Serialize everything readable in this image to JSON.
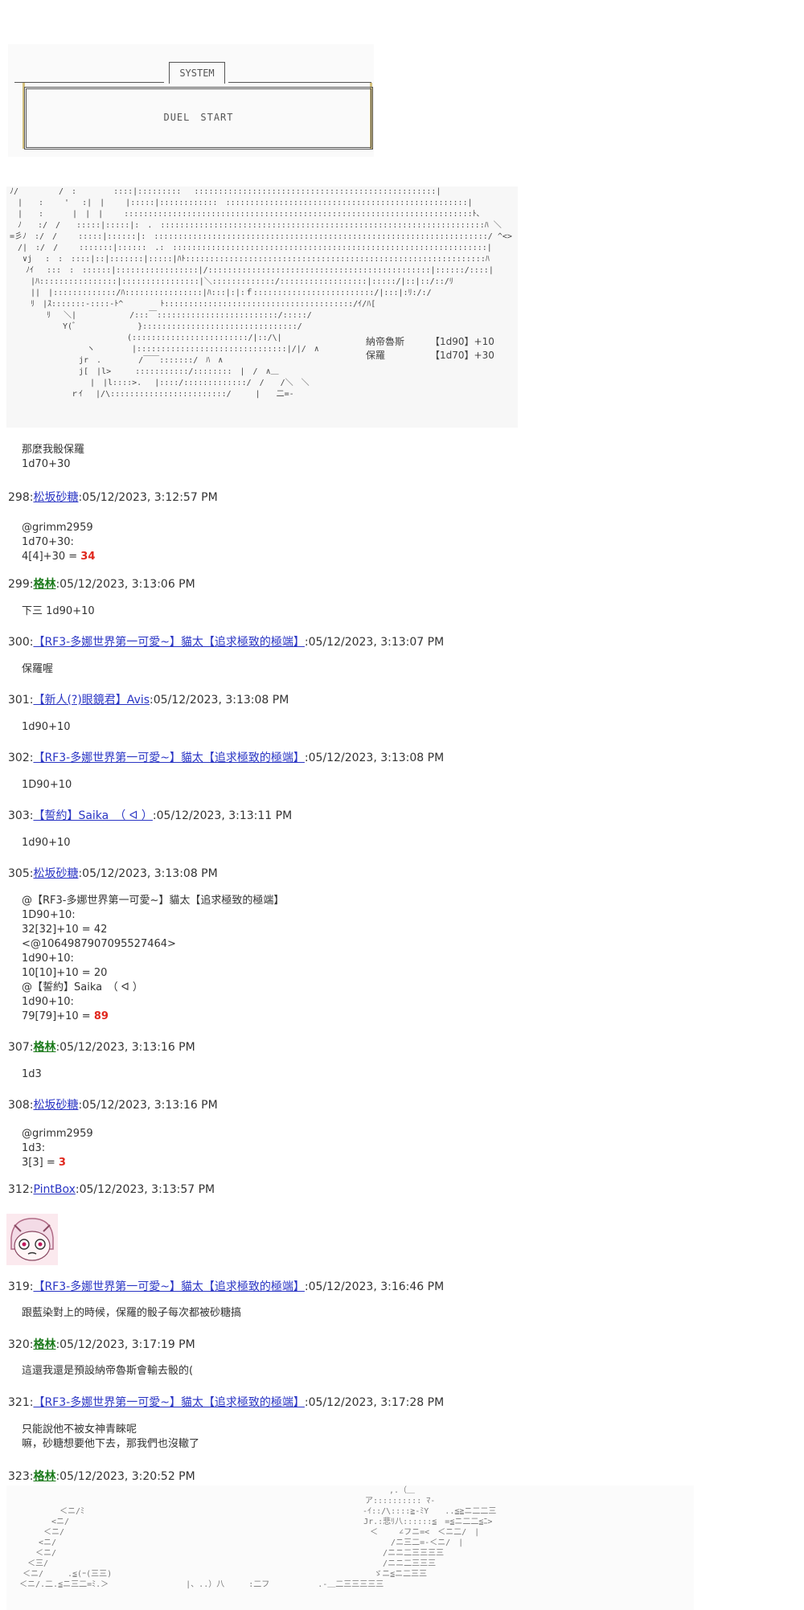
{
  "system_box": {
    "title": "SYSTEM",
    "text": "DUEL　START"
  },
  "scene_art": "ﾉ/　　　　　/　:　　　　 ::::|:::::::::　 ::::::::::::::::::::::::::::::::::::::::::::::::::|\n　|　　:　　 '　 :|　|　　 |:::::|::::::::::::　::::::::::::::::::::::::::::::::::::::::::::::::::|\n　|　　:　　　 |　|　|　　 ::::::::::::::::::::::::::::::::::::::::::::::::::::::::::::::::::::::::ﾄ､\n　ﾉ　　:/　/　　:::::|:::::|:　.　:::::::::::::::::::::::::::::::::::::::::::::::::::::::::::::::::::ﾊ ＼\n=彡ﾉ　:/　/　　 :::::|::::::|:　:::::::::::::::::::::::::::::::::::::::::::::::::::::::::::::::::::::/ ^<>\n　/|　:/　/　　 :::::::|::::::　.:　:::::::::::::::::::::::::::::::::::::::::::::::::::::::::::::::::|\n　 ∨j　 :　:　::::|::|:::::::|:::::|ﾊﾄ::::::::::::::::::::::::::::::::::::::::::::::::::::::::::::::ﾊ\n　　ﾉｲ　 :::　:　::::::|:::::::::::::::::|/::::::::::::::::::::::::::::::::::::::::::::::|::::::/::::|\n　　 |ﾊ::::::::::::::::|::::::::::::::::|＼:::::::::::::/::::::::::::::::::|:::::/|::|::/::/ﾘ\n　　 ||　|:::::::::::::/ﾊ::::::::::::::::|ﾊ:::|:|:ｆ:::::::::::::::::::::::::/|:::|:ﾘ:/:/\n　　 ﾘ　|ｽ:::::::-::::-ﾄ^　　　　 ﾄ:::::::::::::::::::::::::::::::::::::::/ｲ/ﾊ[\n　　　　 ﾘ　 ＼|　　　　　　 /:::￣:::::::::::::::::::::::::/:::::/\n　　　　　　 Y(ﾞ　　　　　　　 }::::::::::::::::::::::::::::::::/\n　　　　　　　　　　　　　　 (::::::::::::::::::::::::/|::/\\|\n　　　　　　　　　 ヽ　　　　 |:::::::::::::::::::::::::::::::|/|/　∧\n　　　　　　　　 jr　.　　　　 /￣￣:::::::/　ﾊ　∧\n　　　　　　　　 j[　|l>　　　:::::::::::/::::::::　|　/　∧＿\n　　　　　　　　　　|　|l::::>.　 |::::/:::::::::::::/　/　　/＼　＼\n　　　　　　　 ｒｲ　 |/\\::::::::::::::::::::::::/　　　|　　二=-",
  "stats": [
    {
      "name": "納帝魯斯",
      "roll": "【1d90】+10"
    },
    {
      "name": "保羅",
      "roll": "【1d70】+30"
    }
  ],
  "posts": [
    {
      "num": "",
      "author": "",
      "time": "",
      "body": "那麼我骰保羅\n1d70+30"
    },
    {
      "num": "298",
      "author": "松坂砂糖",
      "style": "link",
      "time": ":05/12/2023, 3:12:57 PM",
      "body_pre": "@grimm2959\n1d70+30:\n4[4]+30 = ",
      "highlight": "34"
    },
    {
      "num": "299",
      "author": "格林",
      "style": "green",
      "time": ":05/12/2023, 3:13:06 PM",
      "body": "下三 1d90+10"
    },
    {
      "num": "300",
      "author": "【RF3-多娜世界第一可愛~】貓太【追求極致的極端】",
      "style": "link",
      "time": ":05/12/2023, 3:13:07 PM",
      "body": "保羅喔"
    },
    {
      "num": "301",
      "author": "【新人(?)眼鏡君】Avis",
      "style": "link",
      "time": ":05/12/2023, 3:13:08 PM",
      "body": "1d90+10"
    },
    {
      "num": "302",
      "author": "【RF3-多娜世界第一可愛~】貓太【追求極致的極端】",
      "style": "link",
      "time": ":05/12/2023, 3:13:08 PM",
      "body": "1D90+10"
    },
    {
      "num": "303",
      "author": "【誓約】Saika　（ ᐊ ）",
      "style": "link",
      "time": ":05/12/2023, 3:13:11 PM",
      "body": "1d90+10"
    },
    {
      "num": "305",
      "author": "松坂砂糖",
      "style": "link",
      "time": ":05/12/2023, 3:13:08 PM",
      "body_pre": "@【RF3-多娜世界第一可愛~】貓太【追求極致的極端】\n1D90+10:\n32[32]+10 = 42\n<@1064987907095527464>\n1d90+10:\n10[10]+10 = 20\n@【誓約】Saika　（ ᐊ ）\n1d90+10:\n79[79]+10 = ",
      "highlight": "89"
    },
    {
      "num": "307",
      "author": "格林",
      "style": "green",
      "time": ":05/12/2023, 3:13:16 PM",
      "body": "1d3"
    },
    {
      "num": "308",
      "author": "松坂砂糖",
      "style": "link",
      "time": ":05/12/2023, 3:13:16 PM",
      "body_pre": "@grimm2959\n1d3:\n3[3] = ",
      "highlight": "3"
    },
    {
      "num": "312",
      "author": "PintBox",
      "style": "link",
      "time": ":05/12/2023, 3:13:57 PM",
      "body": ""
    },
    {
      "num": "319",
      "author": "【RF3-多娜世界第一可愛~】貓太【追求極致的極端】",
      "style": "link",
      "time": ":05/12/2023, 3:16:46 PM",
      "body": "跟藍染對上的時候，保羅的骰子每次都被砂糖搞"
    },
    {
      "num": "320",
      "author": "格林",
      "style": "green",
      "time": ":05/12/2023, 3:17:19 PM",
      "body": "這還我還是預設納帝魯斯會輸去骰的("
    },
    {
      "num": "321",
      "author": "【RF3-多娜世界第一可愛~】貓太【追求極致的極端】",
      "style": "link",
      "time": ":05/12/2023, 3:17:28 PM",
      "body": "只能說他不被女神青睞呢\n嘛，砂糖想要他下去，那我們也沒轍了"
    },
    {
      "num": "323",
      "author": "格林",
      "style": "green",
      "time": ":05/12/2023, 3:20:52 PM",
      "body": ""
    }
  ],
  "bottom_art": "　　　　　　　　　　　　　　　　　　　　　　　　　　　　　　　　　　　　　　　　　　　　　　　 ,.（＿\n　　　　　　　　　　　　　　　　　　　　　　　　　　　　　　　　　　　　　　　　　　　　 ア:::::::::: ﾏ-\n　　　　　　 ＜ニ/ﾐ　　　　　　　　　　　　　　　　　　　　　　　　　　　　　　　　　　 -ｲ::/\\::::≧-ﾐY　　..≦≧ニ二二三\n　　　　　 <ニ/　　　　　　　　　　　　　　　　　　　　　　　　　　　　　　　　　　　　 Jr.:悲ﾘ八::::::≦　=≦ニ二二≦ﾆ>\n　　　　 ＜ニ/　　　　　　　　　　　　　　　　　　　　　　　　　　　　　　　　　　　　　　＜　　 ∠フニ=<　＜ニ二/　|\n　　　　<ニ/　　　　　　　　　　　　　　　　　　　　　　　　　　　　　　　　　　　　　　　　　 /ニ三二=-＜ニ/　|\n　　　 ＜ニ/　　　　　　　　　　　　　　　　　　　　　　　　　　　　　　　　　　　　　　　　 /ニニ二三三三三\n　　 ＜三/　　　　　　　　　　　　　　　　　　　　　　　　　　　　　　　　　　　　　　　　　 /ニニ二三三三\n　　＜ニ/　　　.≦(ｰ(三三)　　　　　　　　　　　　　　　　　　　　　　　　　　　　　　　　 ゞニ≦ニ二三三\n　 ＜ニ/.二.≦ニ三二=ﾐ.＞　　　　　　　　　 |、..）八　　　:二フ　　　　　　.-＿二三三三三三"
}
